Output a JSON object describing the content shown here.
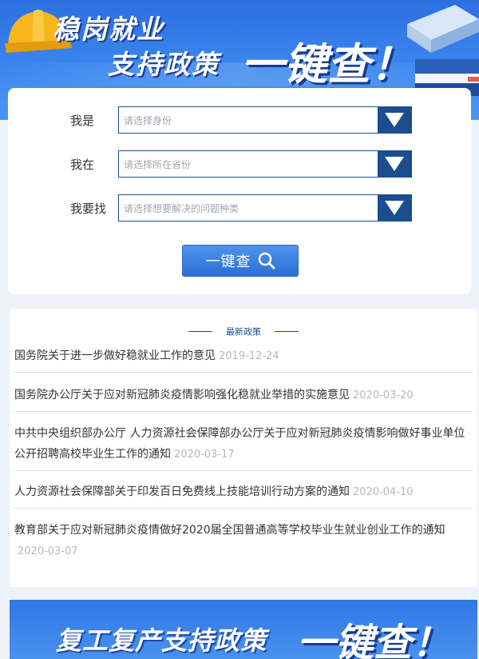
{
  "banner": {
    "title_line1": "稳岗就业",
    "title_line2": "支持政策",
    "title_big": "一键查！"
  },
  "form": {
    "fields": [
      {
        "label": "我是",
        "placeholder": "请选择身份"
      },
      {
        "label": "我在",
        "placeholder": "请选择所在省份"
      },
      {
        "label": "我要找",
        "placeholder": "请选择想要解决的问题种类"
      }
    ],
    "search_button": "一键查"
  },
  "news": {
    "title": "最新政策",
    "items": [
      {
        "text": "国务院关于进一步做好稳就业工作的意见",
        "date": "2019-12-24"
      },
      {
        "text": "国务院办公厅关于应对新冠肺炎疫情影响强化稳就业举措的实施意见",
        "date": "2020-03-20"
      },
      {
        "text": "中共中央组织部办公厅 人力资源社会保障部办公厅关于应对新冠肺炎疫情影响做好事业单位公开招聘高校毕业生工作的通知",
        "date": "2020-03-17"
      },
      {
        "text": "人力资源社会保障部关于印发百日免费线上技能培训行动方案的通知",
        "date": "2020-04-10"
      },
      {
        "text": "教育部关于应对新冠肺炎疫情做好2020届全国普通高等学校毕业生就业创业工作的通知",
        "date": "2020-03-07"
      }
    ]
  },
  "banner2": {
    "title": "复工复产支持政策",
    "title_big": "一键查！"
  },
  "colors": {
    "primary_dark": "#1b4d8f",
    "banner_blue": "#3a86ee",
    "date_gray": "#b5b9bf"
  }
}
